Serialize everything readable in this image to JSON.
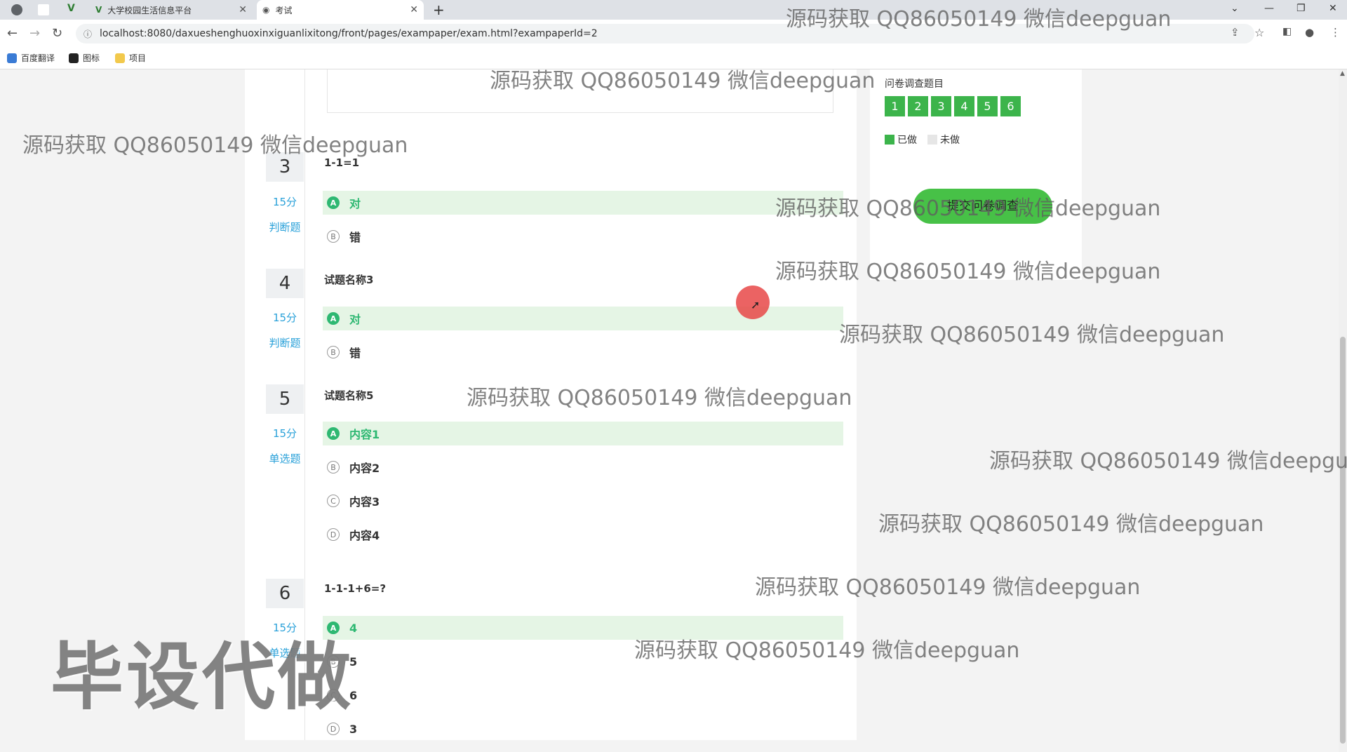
{
  "browser": {
    "tabs": [
      {
        "title": "大学校园生活信息平台"
      },
      {
        "title": "考试"
      }
    ],
    "url": "localhost:8080/daxueshenghuoxinxiguanlixitong/front/pages/exampaper/exam.html?exampaperId=2",
    "bookmarks": [
      "百度翻译",
      "图标",
      "项目"
    ]
  },
  "questions": [
    {
      "num": "3",
      "score": "15分",
      "type": "判断题",
      "title": "1-1=1",
      "options": [
        {
          "letter": "A",
          "text": "对",
          "selected": true
        },
        {
          "letter": "B",
          "text": "错",
          "selected": false
        }
      ]
    },
    {
      "num": "4",
      "score": "15分",
      "type": "判断题",
      "title": "试题名称3",
      "options": [
        {
          "letter": "A",
          "text": "对",
          "selected": true
        },
        {
          "letter": "B",
          "text": "错",
          "selected": false
        }
      ]
    },
    {
      "num": "5",
      "score": "15分",
      "type": "单选题",
      "title": "试题名称5",
      "options": [
        {
          "letter": "A",
          "text": "内容1",
          "selected": true
        },
        {
          "letter": "B",
          "text": "内容2",
          "selected": false
        },
        {
          "letter": "C",
          "text": "内容3",
          "selected": false
        },
        {
          "letter": "D",
          "text": "内容4",
          "selected": false
        }
      ]
    },
    {
      "num": "6",
      "score": "15分",
      "type": "单选题",
      "title": "1-1-1+6=?",
      "options": [
        {
          "letter": "A",
          "text": "4",
          "selected": true
        },
        {
          "letter": "B",
          "text": "5",
          "selected": false
        },
        {
          "letter": "C",
          "text": "6",
          "selected": false
        },
        {
          "letter": "D",
          "text": "3",
          "selected": false
        }
      ]
    }
  ],
  "side": {
    "title": "问卷调查题目",
    "buttons": [
      "1",
      "2",
      "3",
      "4",
      "5",
      "6"
    ],
    "legend_done": "已做",
    "legend_todo": "未做",
    "submit_label": "提交问卷调查",
    "done_color": "#3cb44b"
  },
  "watermark_text": "源码获取 QQ86050149 微信deepguan",
  "stamp_text": "毕设代做"
}
